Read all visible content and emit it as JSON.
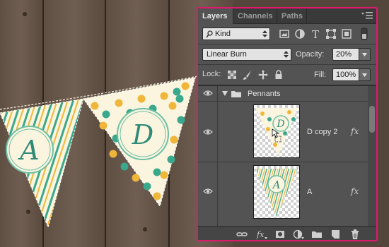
{
  "panel": {
    "tabs": [
      "Layers",
      "Channels",
      "Paths"
    ],
    "filter": {
      "label": "Kind"
    },
    "blend_mode": "Linear Burn",
    "opacity_label": "Opacity:",
    "opacity_value": "20%",
    "lock_label": "Lock:",
    "fill_label": "Fill:",
    "fill_value": "100%",
    "layers": [
      {
        "name": "Pennants",
        "type": "group",
        "expanded": true
      },
      {
        "name": "D copy 2",
        "type": "layer",
        "fx": "fx",
        "letter": "D"
      },
      {
        "name": "A",
        "type": "layer",
        "fx": "fx",
        "letter": "A"
      }
    ]
  },
  "artwork": {
    "letters": [
      "A",
      "D"
    ],
    "colors": {
      "accent": "#e0196e",
      "teal": "#3aa88c",
      "yellow": "#f0b63a",
      "cream": "#fbf5df",
      "letter": "#2f8a78"
    }
  }
}
